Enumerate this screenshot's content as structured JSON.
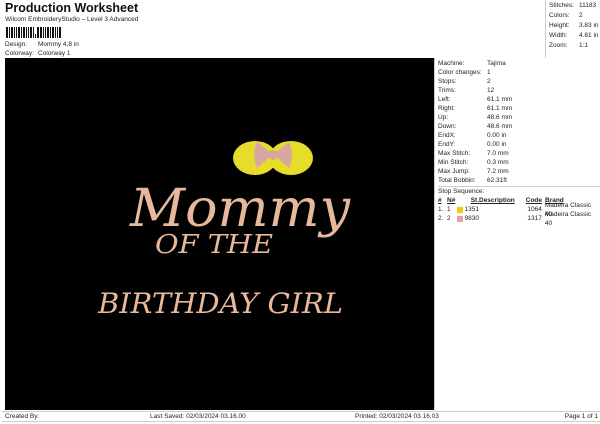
{
  "header": {
    "title": "Production Worksheet",
    "subtitle": "Wilcom EmbroideryStudio – Level 3 Advanced",
    "design_label": "Design:",
    "design": "Mommy 4,8 in",
    "colorway_label": "Colorway:",
    "colorway": "Colorway 1"
  },
  "stats": [
    {
      "k": "Stitches:",
      "v": "11183"
    },
    {
      "k": "Colors:",
      "v": "2"
    },
    {
      "k": "Height:",
      "v": "3.83 in"
    },
    {
      "k": "Width:",
      "v": "4.81 in"
    },
    {
      "k": "Zoom:",
      "v": "1:1"
    }
  ],
  "design_art": {
    "line1": "Mommy",
    "line2": "OF THE",
    "line3": "BIRTHDAY GIRL",
    "text_color": "#e8b89c",
    "ears_color": "#e6dc2a",
    "bow_color": "#d8a8a0"
  },
  "props": [
    {
      "k": "Machine:",
      "v": "Tajima"
    },
    {
      "k": "Color changes:",
      "v": "1"
    },
    {
      "k": "Stops:",
      "v": "2"
    },
    {
      "k": "Trims:",
      "v": "12"
    },
    {
      "k": "Left:",
      "v": "61.1 mm"
    },
    {
      "k": "Right:",
      "v": "61.1 mm"
    },
    {
      "k": "Up:",
      "v": "48.6 mm"
    },
    {
      "k": "Down:",
      "v": "48.6 mm"
    },
    {
      "k": "EndX:",
      "v": "0.00 in"
    },
    {
      "k": "EndY:",
      "v": "0.00 in"
    },
    {
      "k": "Max Stitch:",
      "v": "7.0 mm"
    },
    {
      "k": "Min Stitch:",
      "v": "0.3 mm"
    },
    {
      "k": "Max Jump:",
      "v": "7.2 mm"
    },
    {
      "k": "Total Bobbin:",
      "v": "62.31ft"
    }
  ],
  "stop_sequence": {
    "title": "Stop Sequence:",
    "headers": [
      "#",
      "N#",
      "St.",
      "Description",
      "Code",
      "Brand"
    ],
    "rows": [
      {
        "num": "1.",
        "n": "1",
        "color": "#f5c518",
        "st": "1351",
        "desc": "",
        "code": "1064",
        "brand": "Madeira Classic 40"
      },
      {
        "num": "2.",
        "n": "2",
        "color": "#e8a0a0",
        "st": "9830",
        "desc": "",
        "code": "1317",
        "brand": "Madeira Classic 40"
      }
    ]
  },
  "footer": {
    "created": "Created By:",
    "saved": "Last Saved: 02/03/2024 03.16.00",
    "printed": "Printed: 02/03/2024 03.16.03",
    "page": "Page 1 of 1"
  }
}
